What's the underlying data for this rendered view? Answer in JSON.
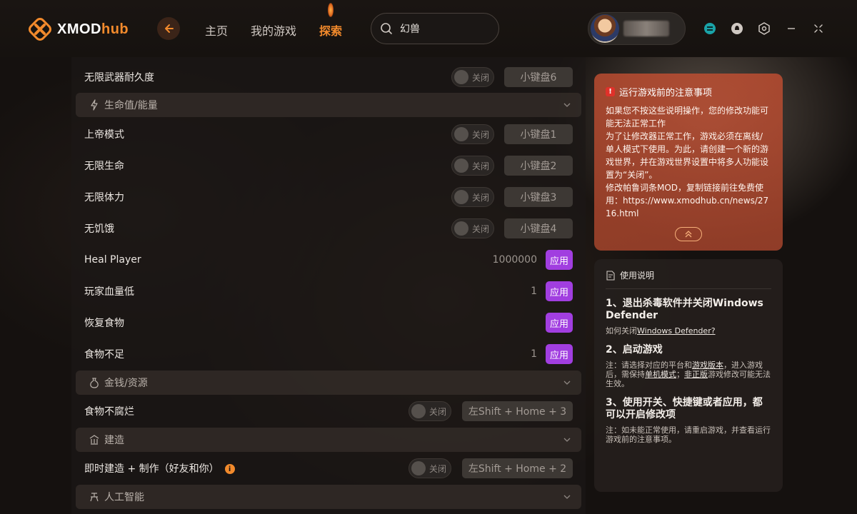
{
  "app": {
    "logo_x": "XMOD",
    "logo_hub": "hub"
  },
  "nav": {
    "home": "主页",
    "my_games": "我的游戏",
    "explore": "探索"
  },
  "search": {
    "value": "幻兽"
  },
  "main": {
    "rows": [
      {
        "label": "无限武器耐久度",
        "toggle": "关闭",
        "hotkey": "小键盘6"
      },
      {
        "section": "生命值/能量"
      },
      {
        "label": "上帝模式",
        "toggle": "关闭",
        "hotkey": "小键盘1"
      },
      {
        "label": "无限生命",
        "toggle": "关闭",
        "hotkey": "小键盘2"
      },
      {
        "label": "无限体力",
        "toggle": "关闭",
        "hotkey": "小键盘3"
      },
      {
        "label": "无饥饿",
        "toggle": "关闭",
        "hotkey": "小键盘4"
      },
      {
        "label": "Heal Player",
        "value": "1000000",
        "apply": "应用"
      },
      {
        "label": "玩家血量低",
        "value": "1",
        "apply": "应用"
      },
      {
        "label": "恢复食物",
        "apply": "应用"
      },
      {
        "label": "食物不足",
        "value": "1",
        "apply": "应用"
      },
      {
        "section": "金钱/资源"
      },
      {
        "label": "食物不腐烂",
        "toggle": "关闭",
        "hotkey": "左Shift + Home + 3"
      },
      {
        "section": "建造"
      },
      {
        "label": "即时建造 + 制作（好友和你）",
        "toggle": "关闭",
        "hotkey": "左Shift + Home + 2"
      },
      {
        "section": "人工智能"
      }
    ]
  },
  "notice": {
    "title": "运行游戏前的注意事项",
    "body_1": "如果您不按这些说明操作，您的修改功能可能无法正常工作",
    "body_2": "为了让修改器正常工作，游戏必须在离线/单人模式下使用。为此，请创建一个新的游戏世界，并在游戏世界设置中将多人功能设置为“关闭”。",
    "body_3": "修改帕鲁词条MOD，复制链接前往免费使用：https://www.xmodhub.cn/news/2716.html"
  },
  "help": {
    "title": "使用说明",
    "step1_title": "1、退出杀毒软件并关闭Windows Defender",
    "step1_text_a": "如何关闭",
    "step1_link": "Windows Defender?",
    "step2_title": "2、启动游戏",
    "step2_a": "注：请选择对应的平台和",
    "step2_b": "游戏版本",
    "step2_c": "，进入游戏后，需保持",
    "step2_d": "单机模式",
    "step2_e": "；",
    "step2_f": "非正版",
    "step2_g": "游戏修改可能无法生效。",
    "step3_title": "3、使用开关、快捷键或者应用，都可以开启修改项",
    "step3_text": "注：如未能正常使用，请重启游戏，并查看运行游戏前的注意事项。"
  },
  "colors": {
    "accent": "#f28a2c",
    "apply": "#a13ee0",
    "notice": "#c25535"
  },
  "icons": [
    "logo-icon",
    "back-arrow-icon",
    "search-icon",
    "app-icon",
    "notification-icon",
    "settings-icon",
    "minimize-icon",
    "close-icon",
    "lightning-icon",
    "money-bag-icon",
    "building-icon",
    "robot-icon",
    "chevron-down-icon",
    "warning-icon",
    "chevron-up-icon",
    "document-icon"
  ]
}
